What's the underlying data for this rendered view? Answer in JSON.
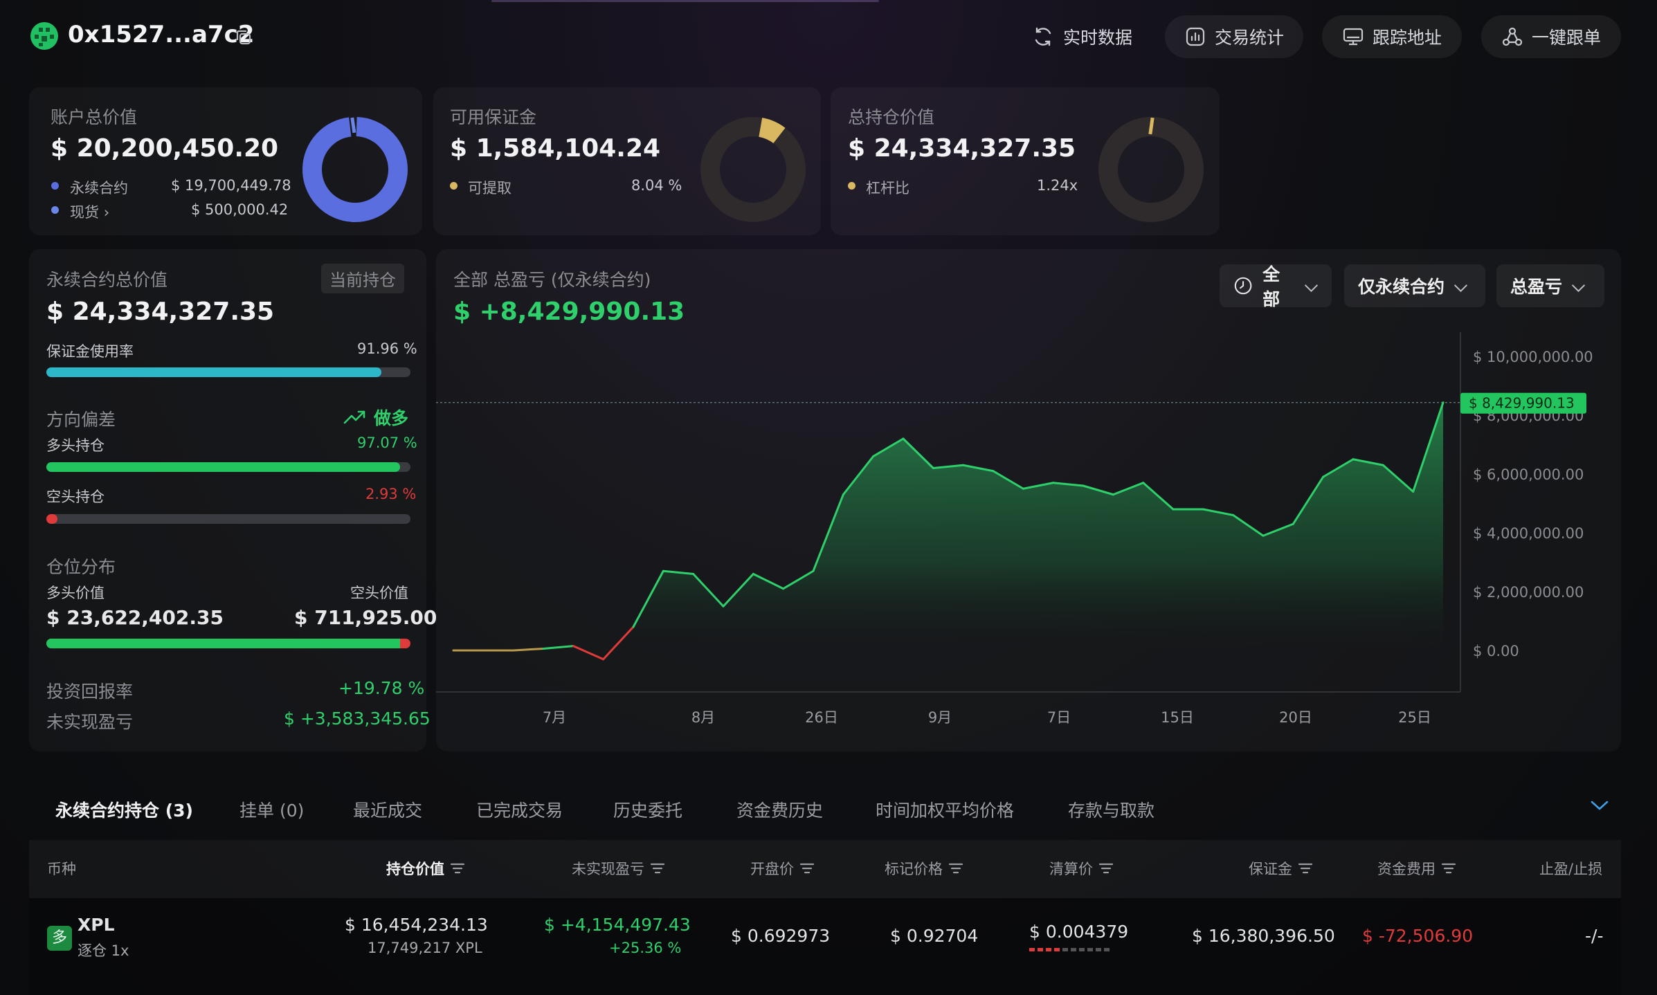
{
  "header": {
    "address": "0x1527...a7c2",
    "realtime": "实时数据",
    "stats": "交易统计",
    "track": "跟踪地址",
    "copytrade": "一键跟单"
  },
  "account": {
    "label": "账户总价值",
    "value": "$ 20,200,450.20",
    "perp_label": "永续合约",
    "perp_value": "$ 19,700,449.78",
    "spot_label": "现货",
    "spot_value": "$ 500,000.42",
    "perp_color": "#5b6ee0",
    "spot_color": "#6a86e8",
    "perp_fraction": 0.975
  },
  "margin": {
    "label": "可用保证金",
    "value": "$ 1,584,104.24",
    "withdraw_label": "可提取",
    "withdraw_value": "8.04 %",
    "fraction": 0.0804,
    "color": "#d9b861"
  },
  "position": {
    "label": "总持仓价值",
    "value": "$ 24,334,327.35",
    "lev_label": "杠杆比",
    "lev_value": "1.24x",
    "fraction": 0.0124,
    "color": "#d9b861"
  },
  "perp_panel": {
    "title": "永续合约总价值",
    "badge": "当前持仓",
    "value": "$ 24,334,327.35",
    "margin_usage_label": "保证金使用率",
    "margin_usage_value": "91.96 %",
    "margin_usage": 0.9196,
    "bias_label": "方向偏差",
    "bias_value": "做多",
    "long_label": "多头持仓",
    "long_pct": "97.07 %",
    "long": 0.9707,
    "short_label": "空头持仓",
    "short_pct": "2.93 %",
    "short": 0.0293,
    "dist_label": "仓位分布",
    "long_val_label": "多头价值",
    "short_val_label": "空头价值",
    "long_val": "$ 23,622,402.35",
    "short_val": "$ 711,925.00",
    "roi_label": "投资回报率",
    "roi_value": "+19.78 %",
    "upnl_label": "未实现盈亏",
    "upnl_value": "$ +3,583,345.65"
  },
  "pnl_panel": {
    "title": "全部 总盈亏 (仅永续合约)",
    "value": "$ +8,429,990.13",
    "filter_all": "全部",
    "filter_perp": "仅永续合约",
    "filter_pnl": "总盈亏"
  },
  "chart_data": {
    "type": "area",
    "yticks": [
      "$ 10,000,000.00",
      "$ 8,000,000.00",
      "$ 6,000,000.00",
      "$ 4,000,000.00",
      "$ 2,000,000.00",
      "$ 0.00"
    ],
    "ytick_values": [
      10000000,
      8000000,
      6000000,
      4000000,
      2000000,
      0
    ],
    "xticks": [
      "7月",
      "8月",
      "26日",
      "9月",
      "7日",
      "15日",
      "20日",
      "25日"
    ],
    "ylim": [
      0,
      10000000
    ],
    "current_label": "$ 8,429,990.13",
    "current": 8429990.13,
    "values": [
      0,
      0,
      0,
      60000,
      150000,
      -300000,
      800000,
      2700000,
      2600000,
      1500000,
      2600000,
      2100000,
      2700000,
      5300000,
      6600000,
      7200000,
      6200000,
      6300000,
      6100000,
      5500000,
      5700000,
      5600000,
      5300000,
      5700000,
      4800000,
      4800000,
      4600000,
      3900000,
      4300000,
      5900000,
      6500000,
      6300000,
      5400000,
      8429990
    ],
    "line_color": "#2fd06c",
    "neg_color": "#e03b3b"
  },
  "tabs": [
    "永续合约持仓 (3)",
    "挂单 (0)",
    "最近成交",
    "已完成交易",
    "历史委托",
    "资金费历史",
    "时间加权平均价格",
    "存款与取款"
  ],
  "table": {
    "headers": [
      "币种",
      "持仓价值",
      "未实现盈亏",
      "开盘价",
      "标记价格",
      "清算价",
      "保证金",
      "资金费用",
      "止盈/止损"
    ],
    "row": {
      "side": "多",
      "coin": "XPL",
      "mode": "逐仓 1x",
      "value": "$ 16,454,234.13",
      "qty": "17,749,217 XPL",
      "upnl": "$ +4,154,497.43",
      "upnl_pct": "+25.36 %",
      "open": "$ 0.692973",
      "mark": "$ 0.92704",
      "liq": "$ 0.004379",
      "margin": "$ 16,380,396.50",
      "funding": "$ -72,506.90",
      "tpsl": "-/-"
    }
  }
}
